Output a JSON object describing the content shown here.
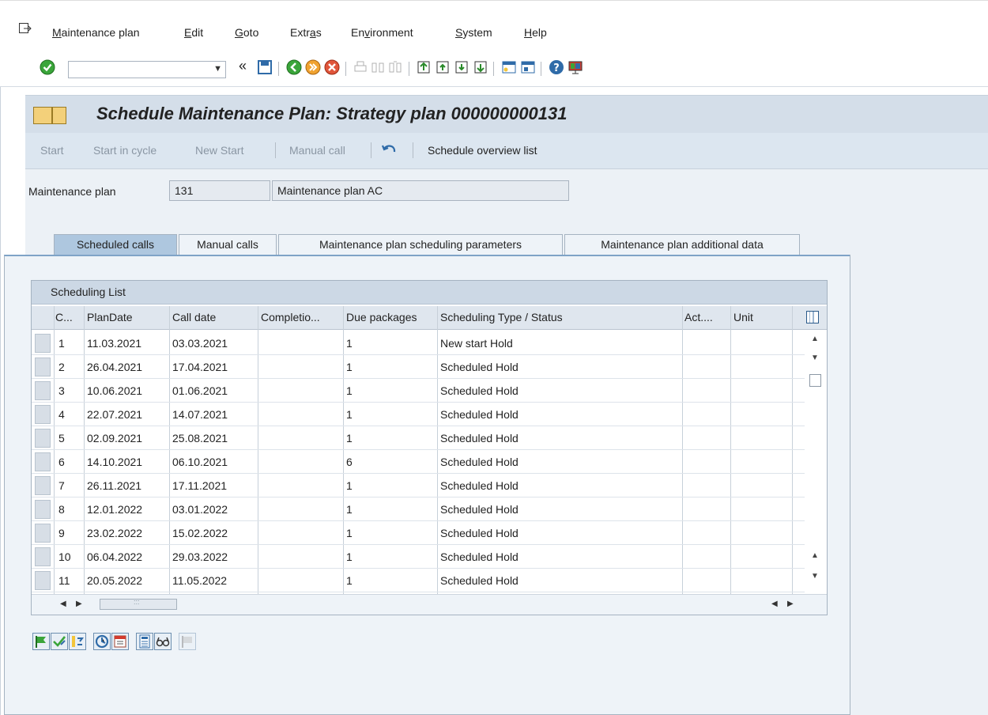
{
  "menu": {
    "items": [
      {
        "pre": "",
        "u": "M",
        "post": "aintenance plan"
      },
      {
        "pre": "",
        "u": "E",
        "post": "dit"
      },
      {
        "pre": "",
        "u": "G",
        "post": "oto"
      },
      {
        "pre": "Extr",
        "u": "a",
        "post": "s"
      },
      {
        "pre": "En",
        "u": "v",
        "post": "ironment"
      },
      {
        "pre": "",
        "u": "S",
        "post": "ystem"
      },
      {
        "pre": "",
        "u": "H",
        "post": "elp"
      }
    ]
  },
  "toolbar": {
    "command_field_value": "",
    "icons": [
      "enter-icon",
      "command-dropdown-icon",
      "collapse-icon",
      "save-icon",
      "back-icon",
      "exit-icon",
      "cancel-icon",
      "print-icon",
      "find-icon",
      "find-next-icon",
      "first-page-icon",
      "previous-page-icon",
      "next-page-icon",
      "last-page-icon",
      "new-session-icon",
      "shortcut-icon",
      "help-icon",
      "customize-layout-icon"
    ]
  },
  "title": {
    "text": "Schedule Maintenance Plan: Strategy plan 000000000131"
  },
  "app_toolbar": {
    "start": "Start",
    "start_in_cycle": "Start in cycle",
    "new_start": "New Start",
    "manual_call": "Manual call",
    "schedule_overview_list": "Schedule overview list"
  },
  "header": {
    "plan_label": "Maintenance plan",
    "plan_number": "131",
    "plan_text": "Maintenance plan AC"
  },
  "tabs": [
    {
      "label": "Scheduled calls",
      "active": true
    },
    {
      "label": "Manual calls",
      "active": false
    },
    {
      "label": "Maintenance plan scheduling parameters",
      "active": false
    },
    {
      "label": "Maintenance plan additional data",
      "active": false
    }
  ],
  "table": {
    "title": "Scheduling List",
    "columns": [
      "C...",
      "PlanDate",
      "Call date",
      "Completio...",
      "Due packages",
      "Scheduling Type / Status",
      "Act....",
      "Unit"
    ],
    "rows": [
      [
        "1",
        "11.03.2021",
        "03.03.2021",
        "",
        "1",
        "New start  Hold",
        "",
        ""
      ],
      [
        "2",
        "26.04.2021",
        "17.04.2021",
        "",
        "1",
        "Scheduled  Hold",
        "",
        ""
      ],
      [
        "3",
        "10.06.2021",
        "01.06.2021",
        "",
        "1",
        "Scheduled  Hold",
        "",
        ""
      ],
      [
        "4",
        "22.07.2021",
        "14.07.2021",
        "",
        "1",
        "Scheduled  Hold",
        "",
        ""
      ],
      [
        "5",
        "02.09.2021",
        "25.08.2021",
        "",
        "1",
        "Scheduled  Hold",
        "",
        ""
      ],
      [
        "6",
        "14.10.2021",
        "06.10.2021",
        "",
        "6",
        "Scheduled  Hold",
        "",
        ""
      ],
      [
        "7",
        "26.11.2021",
        "17.11.2021",
        "",
        "1",
        "Scheduled  Hold",
        "",
        ""
      ],
      [
        "8",
        "12.01.2022",
        "03.01.2022",
        "",
        "1",
        "Scheduled  Hold",
        "",
        ""
      ],
      [
        "9",
        "23.02.2022",
        "15.02.2022",
        "",
        "1",
        "Scheduled  Hold",
        "",
        ""
      ],
      [
        "10",
        "06.04.2022",
        "29.03.2022",
        "",
        "1",
        "Scheduled  Hold",
        "",
        ""
      ],
      [
        "11",
        "20.05.2022",
        "11.05.2022",
        "",
        "1",
        "Scheduled  Hold",
        "",
        ""
      ]
    ],
    "hscroll_grip": ":::"
  },
  "bottom_buttons": [
    "release-call-icon",
    "fix-call-icon",
    "skip-call-icon",
    "reschedule-icon",
    "calendar-icon",
    "calculator-icon",
    "glasses-icon",
    "disabled-flag-icon"
  ],
  "colors": {
    "title_bg": "#d4dee9",
    "app_toolbar_bg": "#dce6f0",
    "body_bg": "#ecf1f6",
    "active_tab": "#aec7df",
    "enter_green": "#3aa53a"
  }
}
